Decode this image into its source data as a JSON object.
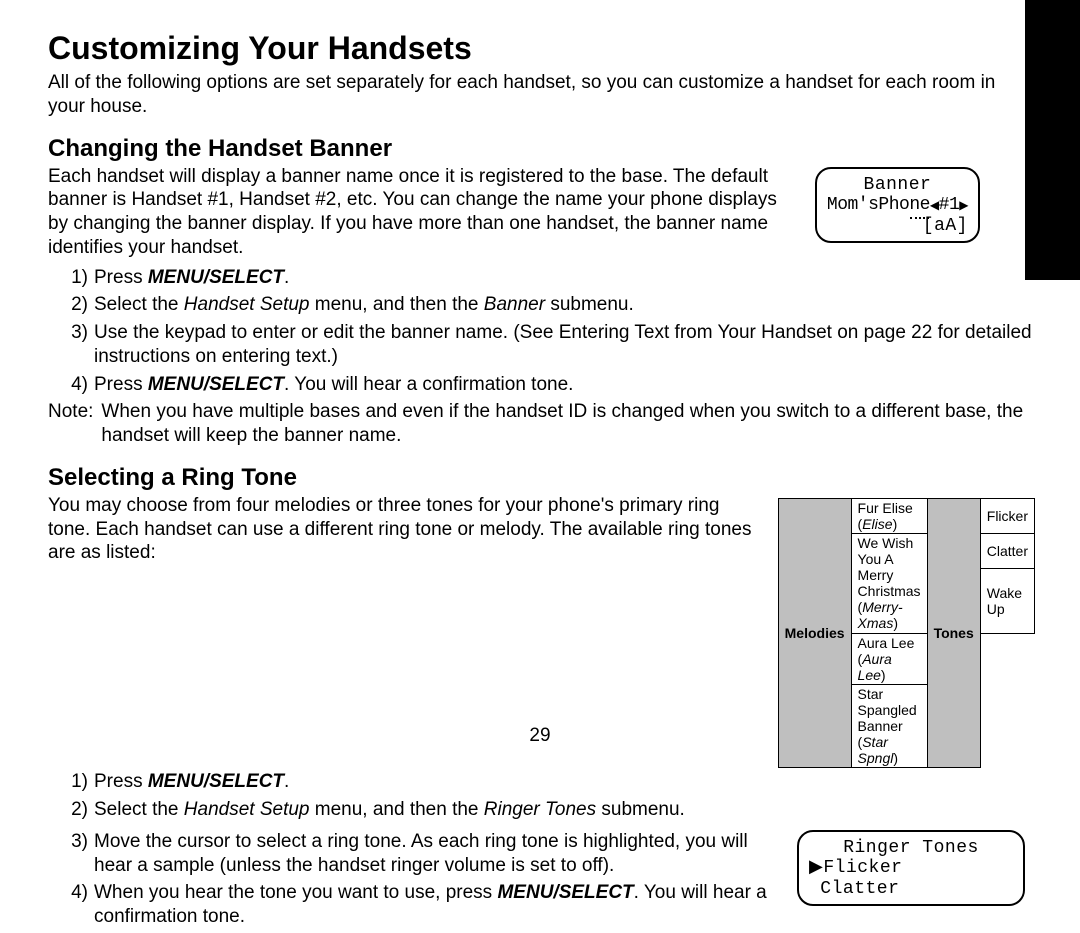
{
  "sidebar_label": "Customizing Your Handsets",
  "h1": "Customizing Your Handsets",
  "intro": "All of the following options are set separately for each handset, so you can customize a handset for each room in your house.",
  "banner": {
    "heading": "Changing the Handset Banner",
    "para": "Each handset will display a banner name once it is registered to the base. The default banner is Handset #1, Handset #2, etc. You can change the name your phone displays by changing the banner display. If you have more than one handset, the banner name identifies your handset.",
    "lcd": {
      "line1": "Banner",
      "l2a": "Mom'sPho",
      "l2b": "ne",
      "l2c": "#1",
      "line3": "[aA]"
    },
    "steps": {
      "s1a": "Press ",
      "s1b": "MENU/SELECT",
      "s1c": ".",
      "s2a": "Select the ",
      "s2b": "Handset Setup",
      "s2c": " menu, and then the ",
      "s2d": "Banner",
      "s2e": " submenu.",
      "s3": "Use the keypad to enter or edit the banner name. (See Entering Text from Your Handset on page 22 for detailed instructions on entering text.)",
      "s4a": "Press ",
      "s4b": "MENU/SELECT",
      "s4c": ". You will hear a confirmation tone."
    },
    "note_label": "Note:",
    "note": "When you have multiple bases and even if the handset ID is changed when you switch to a different base, the handset will keep the banner name."
  },
  "ring": {
    "heading": "Selecting a Ring Tone",
    "para": "You may choose from four melodies or three tones for your phone's primary ring tone. Each handset can use a different ring tone or melody. The available ring tones are as listed:",
    "table": {
      "melodies_hdr": "Melodies",
      "tones_hdr": "Tones",
      "m1a": "Fur Elise (",
      "m1b": "Elise",
      "m1c": ")",
      "m2a": "We Wish You A Merry",
      "m2b_a": "Christmas (",
      "m2b_b": "Merry-Xmas",
      "m2b_c": ")",
      "m3a": "Aura Lee (",
      "m3b": "Aura Lee",
      "m3c": ")",
      "m4a": "Star Spangled Banner",
      "m4b_a": "(",
      "m4b_b": "Star Spngl",
      "m4b_c": ")",
      "t1": "Flicker",
      "t2": "Clatter",
      "t3": "Wake Up"
    },
    "steps": {
      "s1a": "Press ",
      "s1b": "MENU/SELECT",
      "s1c": ".",
      "s2a": "Select the ",
      "s2b": "Handset Setup",
      "s2c": " menu, and then the ",
      "s2d": "Ringer Tones",
      "s2e": " submenu.",
      "s3": "Move the cursor to select a ring tone. As each ring tone is highlighted, you will hear a sample (unless the handset ringer volume is set to off).",
      "s4a": "When you hear the tone you want to use, press ",
      "s4b": "MENU/SELECT",
      "s4c": ". You will hear a confirmation tone."
    },
    "lcd": {
      "line1": "Ringer Tones",
      "line2": "▶Flicker",
      "line3": " Clatter"
    }
  },
  "page_number": "29"
}
